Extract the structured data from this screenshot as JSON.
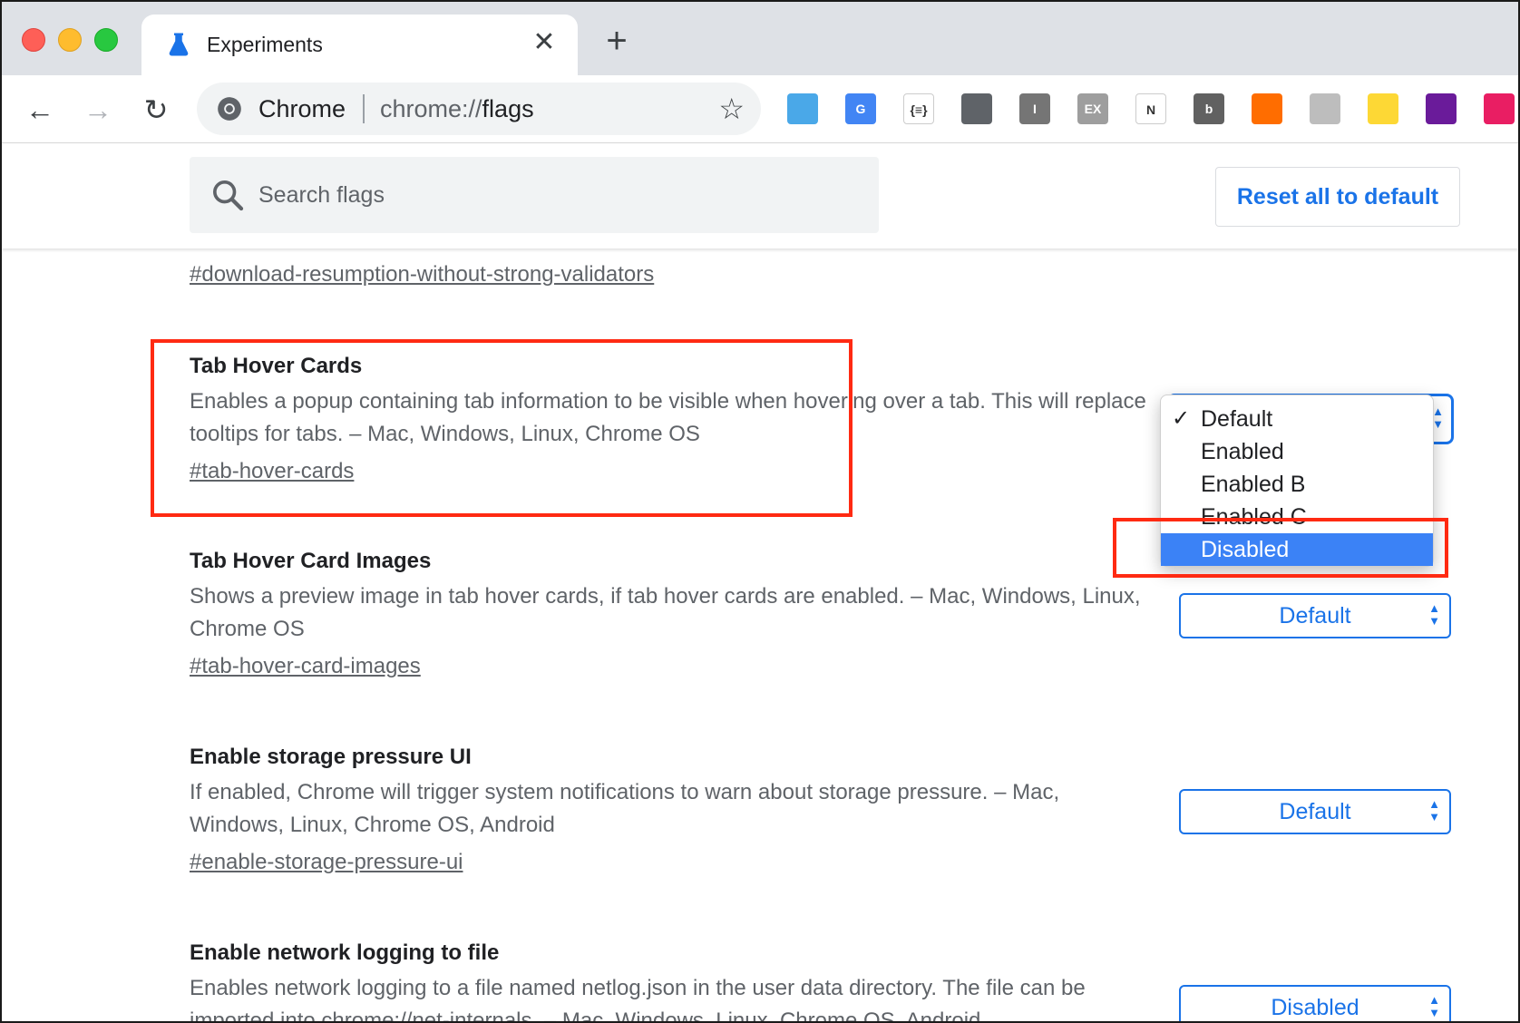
{
  "browser": {
    "tab_title": "Experiments",
    "omnibox": {
      "site_label": "Chrome",
      "url_prefix": "chrome://",
      "url_path": "flags"
    },
    "extensions": [
      {
        "name": "cube-extension",
        "label": "",
        "color": "#4aa8e8"
      },
      {
        "name": "translate-extension",
        "label": "G",
        "color": "#4285f4"
      },
      {
        "name": "json-extension",
        "label": "{≡}",
        "color": "#ffffff"
      },
      {
        "name": "windows-extension",
        "label": "",
        "color": "#5f6368"
      },
      {
        "name": "cursor-extension",
        "label": "I",
        "color": "#757575"
      },
      {
        "name": "ex-extension",
        "label": "EX",
        "color": "#9e9e9e"
      },
      {
        "name": "notes-extension",
        "label": "N",
        "color": "#ffffff"
      },
      {
        "name": "b-extension",
        "label": "b",
        "color": "#616161"
      },
      {
        "name": "analytics-extension",
        "label": "",
        "color": "#ff6d00"
      },
      {
        "name": "clipboard-extension",
        "label": "",
        "color": "#bdbdbd"
      },
      {
        "name": "picker-extension",
        "label": "",
        "color": "#fdd835"
      },
      {
        "name": "image-extension",
        "label": "",
        "color": "#6a1b9a"
      },
      {
        "name": "link-extension",
        "label": "",
        "color": "#e91e63"
      }
    ]
  },
  "header": {
    "search_placeholder": "Search flags",
    "reset_label": "Reset all to default"
  },
  "flags": {
    "prev_link": "#download-resumption-without-strong-validators",
    "tab_hover_cards": {
      "title": "Tab Hover Cards",
      "desc": "Enables a popup containing tab information to be visible when hovering over a tab. This will replace tooltips for tabs. – Mac, Windows, Linux, Chrome OS",
      "link": "#tab-hover-cards"
    },
    "tab_hover_card_images": {
      "title": "Tab Hover Card Images",
      "desc": "Shows a preview image in tab hover cards, if tab hover cards are enabled. – Mac, Windows, Linux, Chrome OS",
      "link": "#tab-hover-card-images",
      "value": "Default"
    },
    "storage_pressure": {
      "title": "Enable storage pressure UI",
      "desc": "If enabled, Chrome will trigger system notifications to warn about storage pressure. – Mac, Windows, Linux, Chrome OS, Android",
      "link": "#enable-storage-pressure-ui",
      "value": "Default"
    },
    "network_logging": {
      "title": "Enable network logging to file",
      "desc": "Enables network logging to a file named netlog.json in the user data directory. The file can be imported into chrome://net-internals. – Mac, Windows, Linux, Chrome OS, Android",
      "value": "Disabled"
    }
  },
  "dropdown": {
    "options": [
      "Default",
      "Enabled",
      "Enabled B",
      "Enabled C",
      "Disabled"
    ],
    "checked": "Default",
    "highlighted": "Disabled"
  },
  "colors": {
    "accent": "#1a73e8",
    "annotation": "#ff2a12",
    "highlight": "#3b82f6"
  }
}
